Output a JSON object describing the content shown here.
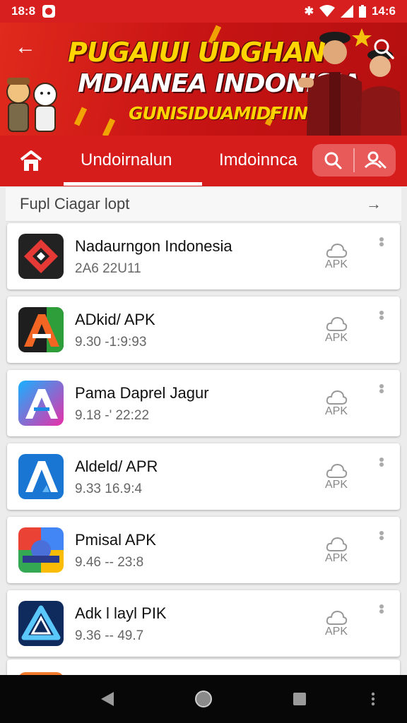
{
  "status_bar": {
    "time": "18:8",
    "battery": "14:6",
    "icons": [
      "notification-icon",
      "bluetooth-icon",
      "wifi-icon",
      "signal-icon",
      "battery-icon"
    ]
  },
  "banner": {
    "title_line1": "PUGAIUI UDGHAN",
    "title_line2": "MDIANEA INDONISIA",
    "subtitle": "GUNISIDUAMIDFIIN!",
    "colors": {
      "primary": "#d71c1c",
      "accent": "#ffd400"
    }
  },
  "tabs": [
    {
      "label": "Undoirnalun",
      "active": true
    },
    {
      "label": "Imdoinnca",
      "active": false
    }
  ],
  "section": {
    "title": "Fupl Ciagar lopt"
  },
  "apps": [
    {
      "name": "Nadaurngon Indonesia",
      "meta": "2A6 22U11",
      "action": "APK",
      "icon": "red-diamond-app-icon"
    },
    {
      "name": "ADkid/ APK",
      "meta": "9.30 -1:9:93",
      "action": "APK",
      "icon": "letter-a-app-icon"
    },
    {
      "name": "Pama Daprel Jagur",
      "meta": "9.18 -' 22:22",
      "action": "APK",
      "icon": "blue-a-app-icon"
    },
    {
      "name": "Aldeld/ APR",
      "meta": "9.33 16.9:4",
      "action": "APK",
      "icon": "blue-triangle-app-icon"
    },
    {
      "name": "Pmisal APK",
      "meta": "9.46 -- 23:8",
      "action": "APK",
      "icon": "google-colors-app-icon"
    },
    {
      "name": "Adk l layl PIK",
      "meta": "9.36 -- 49.7",
      "action": "APK",
      "icon": "navy-triangle-app-icon"
    }
  ],
  "nav": [
    "back-icon",
    "home-icon",
    "recents-icon",
    "menu-icon"
  ]
}
